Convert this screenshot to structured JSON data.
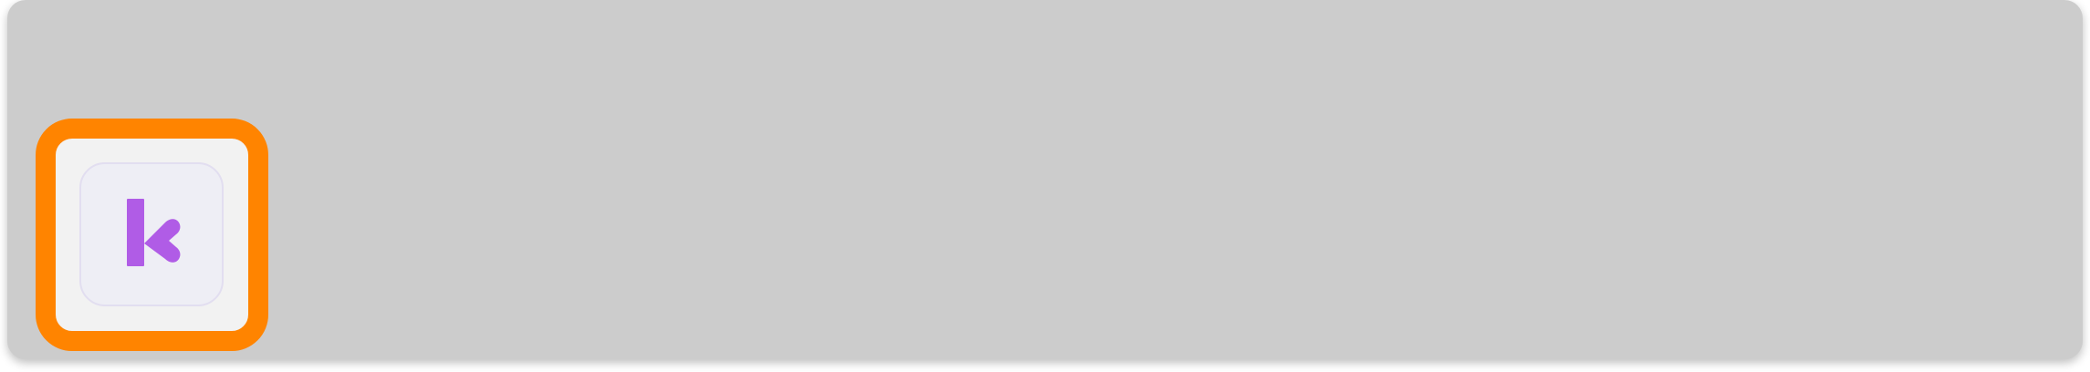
{
  "app": {
    "icon": "k-logo-icon",
    "icon_letter": "k",
    "accent_color": "#b05ce6",
    "highlight_color": "#ff8400"
  }
}
